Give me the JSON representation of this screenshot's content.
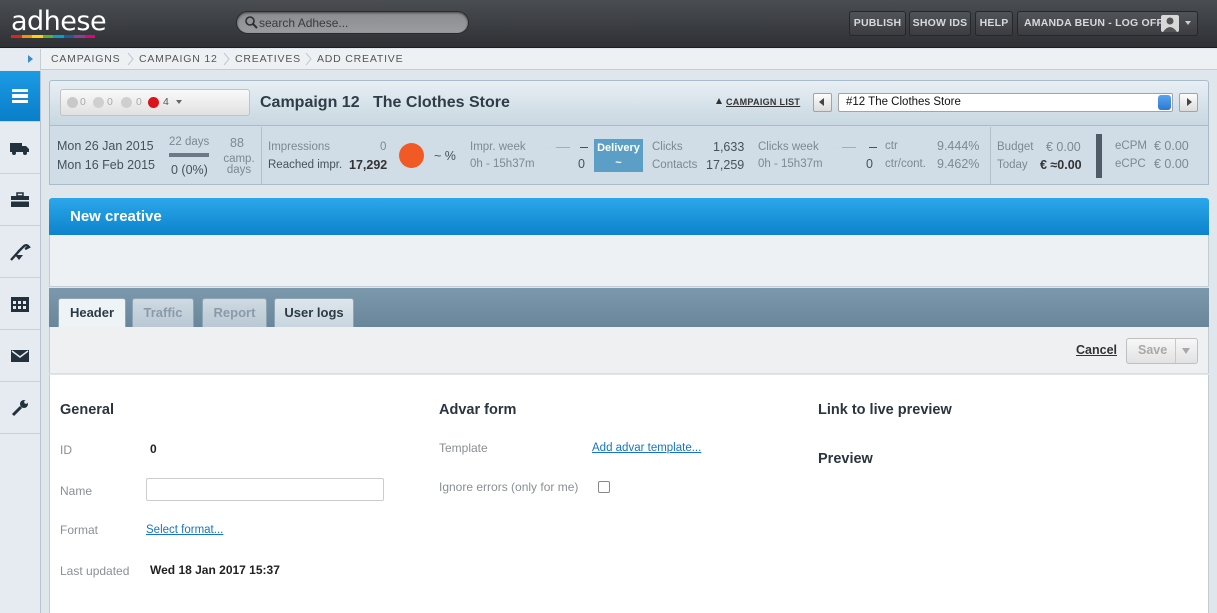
{
  "app": {
    "logo_text": "adhese",
    "logo_colors": [
      "#e2231a",
      "#f39200",
      "#ffd200",
      "#5ab031",
      "#00a0d2",
      "#1d5aa5",
      "#8e3d97",
      "#e6007e"
    ]
  },
  "search": {
    "placeholder": "search Adhese..."
  },
  "topnav": {
    "publish": "PUBLISH",
    "show_ids": "SHOW IDS",
    "help": "HELP",
    "user": "AMANDA BEUN - LOG OFF"
  },
  "breadcrumb": [
    "CAMPAIGNS",
    "CAMPAIGN 12",
    "CREATIVES",
    "ADD CREATIVE"
  ],
  "sidebar": {
    "items": [
      "campaigns-icon",
      "delivery-truck-icon",
      "briefcase-icon",
      "tools-icon",
      "calendar-icon",
      "mail-icon",
      "wrench-icon"
    ]
  },
  "campaign": {
    "status_counts": {
      "inactive": "0",
      "playing": "0",
      "paused": "0",
      "error": "4"
    },
    "title": "Campaign 12",
    "name": "The Clothes Store",
    "list_link": "CAMPAIGN LIST",
    "selected": "#12 The Clothes Store"
  },
  "stats": {
    "start_date": "Mon 26 Jan 2015",
    "end_date": "Mon 16 Feb 2015",
    "days": "22 days",
    "days_progress": "0 (0%)",
    "camp_days_value": "88",
    "camp_days_label": "camp. days",
    "impressions_label": "Impressions",
    "impressions_value": "0",
    "reached_label": "Reached impr.",
    "reached_value": "17,292",
    "percent": "~ %",
    "impr_week_label": "Impr. week",
    "impr_week_range": "0h - 15h37m",
    "impr_week_value": "0",
    "delivery_label": "Delivery",
    "delivery_value": "~",
    "clicks_label": "Clicks",
    "clicks_value": "1,633",
    "contacts_label": "Contacts",
    "contacts_value": "17,259",
    "clicks_week_label": "Clicks week",
    "clicks_week_range": "0h - 15h37m",
    "clicks_week_value": "0",
    "ctr_label": "ctr",
    "ctr_value": "9.444%",
    "ctr_cont_label": "ctr/cont.",
    "ctr_cont_value": "9.462%",
    "budget_label": "Budget",
    "budget_value": "€ 0.00",
    "today_label": "Today",
    "today_value": "€ ≈0.00",
    "ecpm_label": "eCPM",
    "ecpm_value": "€ 0.00",
    "ecpc_label": "eCPC",
    "ecpc_value": "€ 0.00"
  },
  "page": {
    "title": "New creative"
  },
  "tabs": [
    "Header",
    "Traffic",
    "Report",
    "User logs"
  ],
  "actions": {
    "cancel": "Cancel",
    "save": "Save"
  },
  "general": {
    "title": "General",
    "id_label": "ID",
    "id_value": "0",
    "name_label": "Name",
    "name_value": "",
    "format_label": "Format",
    "format_link": "Select format...",
    "updated_label": "Last updated",
    "updated_value": "Wed 18 Jan 2017 15:37"
  },
  "advar": {
    "title": "Advar form",
    "template_label": "Template",
    "template_link": "Add advar template...",
    "ignore_label": "Ignore errors (only for me)",
    "ignore_checked": false
  },
  "preview": {
    "link_title": "Link to live preview",
    "title": "Preview"
  }
}
